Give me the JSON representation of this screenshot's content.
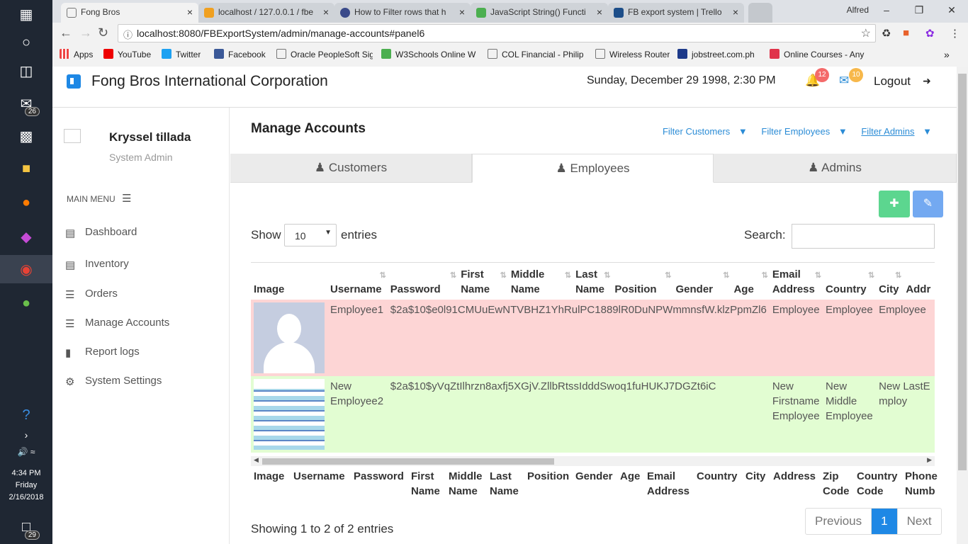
{
  "taskbar": {
    "mail_badge": "26",
    "time": "4:34 PM",
    "day": "Friday",
    "date": "2/16/2018",
    "notif_badge": "29"
  },
  "browser": {
    "profile": "Alfred",
    "tabs": [
      {
        "label": "Fong Bros",
        "favicon": "page-icon"
      },
      {
        "label": "localhost / 127.0.0.1 / fbe",
        "favicon": "phpmyadmin-icon"
      },
      {
        "label": "How to Filter rows that h",
        "favicon": "globe-icon"
      },
      {
        "label": "JavaScript String() Functi",
        "favicon": "w3schools-icon"
      },
      {
        "label": "FB export system | Trello",
        "favicon": "trello-icon"
      }
    ],
    "url": "localhost:8080/FBExportSystem/admin/manage-accounts#panel6",
    "bookmarks": [
      "Apps",
      "YouTube",
      "Twitter",
      "Facebook",
      "Oracle PeopleSoft Sig",
      "W3Schools Online W",
      "COL Financial - Philip",
      "Wireless Router",
      "jobstreet.com.ph",
      "Online Courses - Any"
    ]
  },
  "header": {
    "company": "Fong Bros International Corporation",
    "datetime": "Sunday, December 29 1998, 2:30 PM",
    "notifications_count": "12",
    "messages_count": "10",
    "logout": "Logout"
  },
  "sidebar": {
    "username": "Kryssel tillada",
    "role": "System Admin",
    "main_menu": "MAIN MENU",
    "items": [
      {
        "label": "Dashboard",
        "icon": "dashboard-icon"
      },
      {
        "label": "Inventory",
        "icon": "clipboard-icon"
      },
      {
        "label": "Orders",
        "icon": "list-icon"
      },
      {
        "label": "Manage Accounts",
        "icon": "list-icon"
      },
      {
        "label": "Report logs",
        "icon": "file-icon"
      },
      {
        "label": "System Settings",
        "icon": "gear-icon"
      }
    ]
  },
  "main": {
    "title": "Manage Accounts",
    "filters": [
      "Filter Customers",
      "Filter Employees",
      "Filter Admins"
    ],
    "tabs": [
      "Customers",
      "Employees",
      "Admins"
    ],
    "show": "Show",
    "entries_value": "10",
    "entries": "entries",
    "search_label": "Search:",
    "columns": [
      "Image",
      "Username",
      "Password",
      "First Name",
      "Middle Name",
      "Last Name",
      "Position",
      "Gender",
      "Age",
      "Email Address",
      "Country",
      "City",
      "Addr"
    ],
    "footer_columns": [
      "Image",
      "Username",
      "Password",
      "First Name",
      "Middle Name",
      "Last Name",
      "Position",
      "Gender",
      "Age",
      "Email Address",
      "Country",
      "City",
      "Address",
      "Zip Code",
      "Country Code",
      "Phone Numb"
    ],
    "rows": [
      {
        "username": "Employee1",
        "password": "$2a$10$e0l91CMUuEwNTVBHZ1YhRulPC1889lR0DuNPWmmnsfW.klzPpmZl6",
        "email": "Employee",
        "country": "Employee",
        "city": "Employee"
      },
      {
        "username": "New Employee2",
        "password": "$2a$10$yVqZtIlhrzn8axfj5XGjV.ZllbRtssIdddSwoq1fuHUKJ7DGZt6iC",
        "email": "New Firstname Employee",
        "country": "New Middle Employee",
        "city": "New LastEmploy"
      }
    ],
    "showing": "Showing 1 to 2 of 2 entries",
    "pager": {
      "previous": "Previous",
      "current": "1",
      "next": "Next"
    }
  },
  "colors": {
    "accent": "#1e88e5",
    "row_red": "#fdd5d5",
    "row_green": "#e2fdd2",
    "add_button": "#5cd68f",
    "edit_button": "#73a9f1",
    "notif_badge": "#f46a6a",
    "msg_badge": "#f7b84b"
  }
}
